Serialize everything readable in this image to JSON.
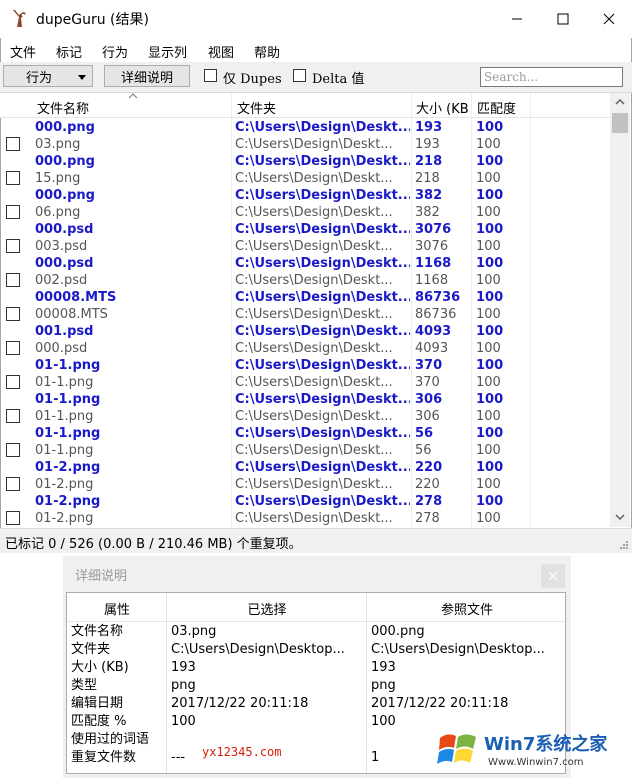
{
  "window": {
    "title": "dupeGuru (结果)"
  },
  "menu": [
    "文件",
    "标记",
    "行为",
    "显示列",
    "视图",
    "帮助"
  ],
  "toolbar": {
    "action_label": "行为",
    "details_label": "详细说明",
    "dupes_only_label": "仅 Dupes",
    "delta_label": "Delta 值",
    "search_placeholder": "Search..."
  },
  "columns": [
    "文件名称",
    "文件夹",
    "大小 (KB)",
    "匹配度"
  ],
  "rows": [
    {
      "ref": true,
      "name": "000.png",
      "folder": "C:\\Users\\Design\\Deskt...",
      "size": "193",
      "match": "100"
    },
    {
      "ref": false,
      "name": "03.png",
      "folder": "C:\\Users\\Design\\Deskt...",
      "size": "193",
      "match": "100"
    },
    {
      "ref": true,
      "name": "000.png",
      "folder": "C:\\Users\\Design\\Deskt...",
      "size": "218",
      "match": "100"
    },
    {
      "ref": false,
      "name": "15.png",
      "folder": "C:\\Users\\Design\\Deskt...",
      "size": "218",
      "match": "100"
    },
    {
      "ref": true,
      "name": "000.png",
      "folder": "C:\\Users\\Design\\Deskt...",
      "size": "382",
      "match": "100"
    },
    {
      "ref": false,
      "name": "06.png",
      "folder": "C:\\Users\\Design\\Deskt...",
      "size": "382",
      "match": "100"
    },
    {
      "ref": true,
      "name": "000.psd",
      "folder": "C:\\Users\\Design\\Deskt...",
      "size": "3076",
      "match": "100"
    },
    {
      "ref": false,
      "name": "003.psd",
      "folder": "C:\\Users\\Design\\Deskt...",
      "size": "3076",
      "match": "100"
    },
    {
      "ref": true,
      "name": "000.psd",
      "folder": "C:\\Users\\Design\\Deskt...",
      "size": "1168",
      "match": "100"
    },
    {
      "ref": false,
      "name": "002.psd",
      "folder": "C:\\Users\\Design\\Deskt...",
      "size": "1168",
      "match": "100"
    },
    {
      "ref": true,
      "name": "00008.MTS",
      "folder": "C:\\Users\\Design\\Deskt...",
      "size": "86736",
      "match": "100"
    },
    {
      "ref": false,
      "name": "00008.MTS",
      "folder": "C:\\Users\\Design\\Deskt...",
      "size": "86736",
      "match": "100"
    },
    {
      "ref": true,
      "name": "001.psd",
      "folder": "C:\\Users\\Design\\Deskt...",
      "size": "4093",
      "match": "100"
    },
    {
      "ref": false,
      "name": "000.psd",
      "folder": "C:\\Users\\Design\\Deskt...",
      "size": "4093",
      "match": "100"
    },
    {
      "ref": true,
      "name": "01-1.png",
      "folder": "C:\\Users\\Design\\Deskt...",
      "size": "370",
      "match": "100"
    },
    {
      "ref": false,
      "name": "01-1.png",
      "folder": "C:\\Users\\Design\\Deskt...",
      "size": "370",
      "match": "100"
    },
    {
      "ref": true,
      "name": "01-1.png",
      "folder": "C:\\Users\\Design\\Deskt...",
      "size": "306",
      "match": "100"
    },
    {
      "ref": false,
      "name": "01-1.png",
      "folder": "C:\\Users\\Design\\Deskt...",
      "size": "306",
      "match": "100"
    },
    {
      "ref": true,
      "name": "01-1.png",
      "folder": "C:\\Users\\Design\\Deskt...",
      "size": "56",
      "match": "100"
    },
    {
      "ref": false,
      "name": "01-1.png",
      "folder": "C:\\Users\\Design\\Deskt...",
      "size": "56",
      "match": "100"
    },
    {
      "ref": true,
      "name": "01-2.png",
      "folder": "C:\\Users\\Design\\Deskt...",
      "size": "220",
      "match": "100"
    },
    {
      "ref": false,
      "name": "01-2.png",
      "folder": "C:\\Users\\Design\\Deskt...",
      "size": "220",
      "match": "100"
    },
    {
      "ref": true,
      "name": "01-2.png",
      "folder": "C:\\Users\\Design\\Deskt...",
      "size": "278",
      "match": "100"
    },
    {
      "ref": false,
      "name": "01-2.png",
      "folder": "C:\\Users\\Design\\Deskt...",
      "size": "278",
      "match": "100"
    }
  ],
  "status": "已标记 0 / 526 (0.00 B / 210.46 MB) 个重复项。",
  "details": {
    "title": "详细说明",
    "headers": [
      "属性",
      "已选择",
      "参照文件"
    ],
    "rows": [
      {
        "attr": "文件名称",
        "selected": "03.png",
        "reference": "000.png"
      },
      {
        "attr": "文件夹",
        "selected": "C:\\Users\\Design\\Desktop...",
        "reference": "C:\\Users\\Design\\Desktop..."
      },
      {
        "attr": "大小 (KB)",
        "selected": "193",
        "reference": "193"
      },
      {
        "attr": "类型",
        "selected": "png",
        "reference": "png"
      },
      {
        "attr": "编辑日期",
        "selected": "2017/12/22 20:11:18",
        "reference": "2017/12/22 20:11:18"
      },
      {
        "attr": "匹配度 %",
        "selected": "100",
        "reference": "100"
      },
      {
        "attr": "使用过的词语",
        "selected": "",
        "reference": ""
      },
      {
        "attr": "重复文件数",
        "selected": "---",
        "reference": "1"
      }
    ]
  },
  "watermark": {
    "site_text": "yx12345.com",
    "brand_text": "Win7系统之家",
    "url_text": "Www.Winwin7.com"
  },
  "colors": {
    "reference_row": "#1a1ac8",
    "duplicate_row": "#555555",
    "toolbar_bg": "#f0f0f0"
  }
}
